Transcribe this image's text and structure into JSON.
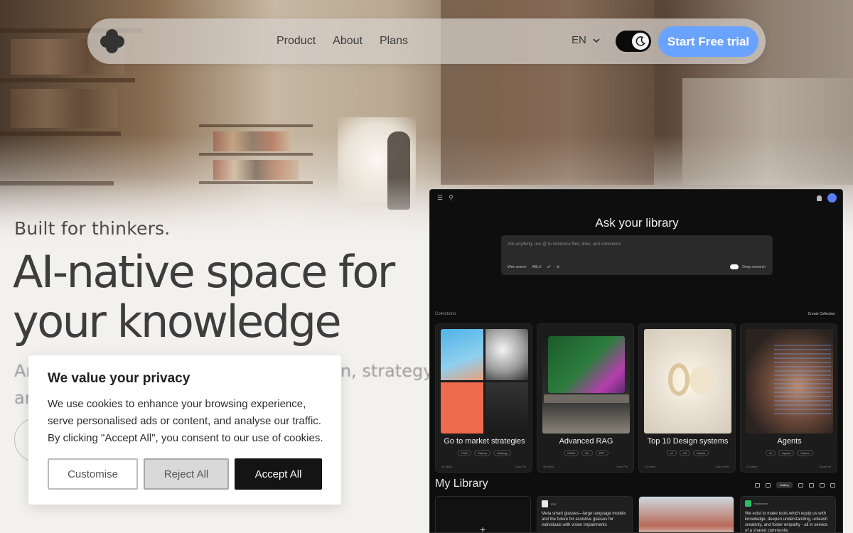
{
  "nav": {
    "links": [
      "Product",
      "About",
      "Plans"
    ],
    "language": "EN",
    "cta_label": "Start Free trial"
  },
  "hero": {
    "kicker": "Built for thinkers.",
    "headline_line1": "AI-native space for",
    "headline_line2": "your knowledge",
    "subtext_line1": "An                                                        n, strategy,",
    "subtext_line2": "an"
  },
  "app": {
    "ask_title": "Ask your library",
    "ask_placeholder": "Ask anything, use @ to reference files, links, and collections",
    "ask_tools": [
      "Web search",
      "ABLU"
    ],
    "deep_research_label": "Deep research",
    "collections_label": "Collections",
    "create_collection_label": "Create Collection",
    "cards": [
      {
        "title": "Go to market strategies",
        "tags": [
          "PMR",
          "Startup",
          "Strategy"
        ],
        "items": "14 Items",
        "owner": "Jean Pie"
      },
      {
        "title": "Advanced RAG",
        "tags": [
          "NASA",
          "ML",
          "RPT"
        ],
        "items": "98 Items",
        "owner": "Jean Pie"
      },
      {
        "title": "Top 10 Design systems",
        "tags": [
          "UI",
          "UX",
          "Assets"
        ],
        "items": "16 Items",
        "owner": "Max Gretz"
      },
      {
        "title": "Agents",
        "tags": [
          "AI",
          "Agents",
          "Python"
        ],
        "items": "23 Items",
        "owner": "Sarah Kit"
      }
    ],
    "library_title": "My Library",
    "gallery_label": "Gallery",
    "library_items": [
      {
        "kind": "PDF",
        "text": "Meta smart glasses—large language models and the future for assistive glasses for individuals with vision impairments"
      },
      {
        "kind": "Hackmoon",
        "text": "We exist to make tools which equip us with knowledge, deepen understanding, unleash creativity, and foster empathy - all in service of a shared community"
      }
    ]
  },
  "cookie": {
    "title": "We value your privacy",
    "body": "We use cookies to enhance your browsing experience, serve personalised ads or content, and analyse our traffic. By clicking \"Accept All\", you consent to our use of cookies.",
    "customise_label": "Customise",
    "reject_label": "Reject All",
    "accept_label": "Accept All"
  },
  "colors": {
    "accent": "#6aa3ff",
    "app_bg": "#0e0e0e",
    "accept_bg": "#141414"
  }
}
